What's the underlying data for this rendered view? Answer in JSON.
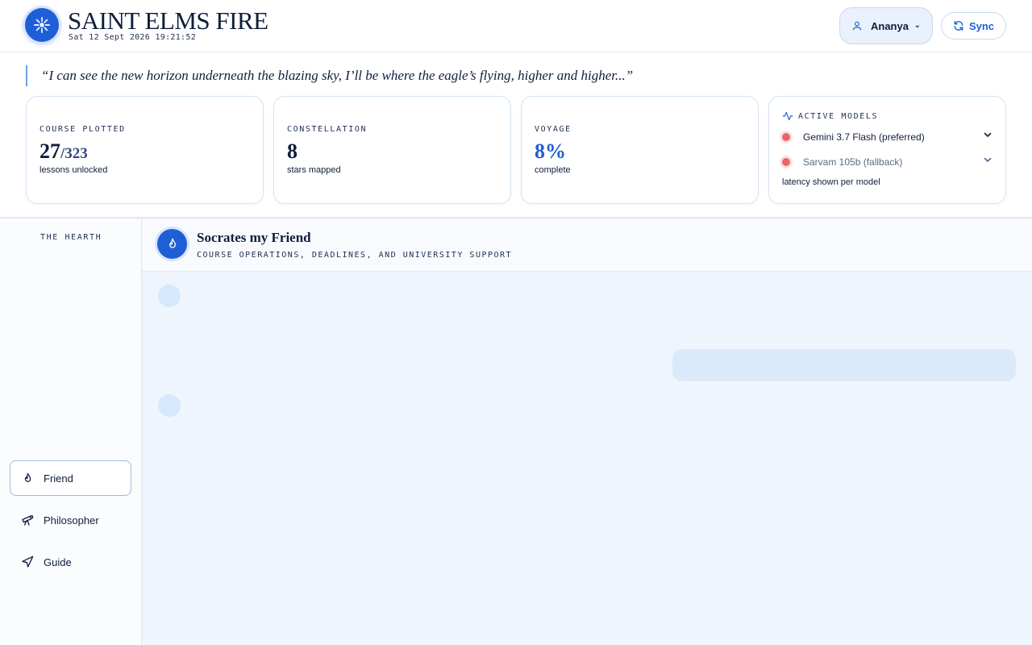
{
  "header": {
    "title": "SAINT ELMS FIRE",
    "datetime": "Sat 12 Sept 2026 19:21:52",
    "user_name": "Ananya",
    "sync_label": "Sync"
  },
  "quote": "“I can see the new horizon underneath the blazing sky, I’ll be where the eagle’s flying, higher and higher...”",
  "stats": {
    "course": {
      "label": "COURSE PLOTTED",
      "value": "27",
      "total": "/323",
      "sub": "lessons unlocked"
    },
    "constellation": {
      "label": "CONSTELLATION",
      "value": "8",
      "sub": "stars mapped"
    },
    "voyage": {
      "label": "VOYAGE",
      "value": "8%",
      "sub": "complete"
    }
  },
  "models": {
    "label": "ACTIVE MODELS",
    "items": [
      {
        "name": "Gemini 3.7 Flash (preferred)",
        "status_color": "#e8666a"
      },
      {
        "name": "Sarvam 105b (fallback)",
        "status_color": "#e8666a"
      }
    ],
    "note": "latency shown per model"
  },
  "sidebar": {
    "section": "THE HEARTH",
    "items": [
      {
        "label": "Friend",
        "icon": "flame-icon",
        "active": true
      },
      {
        "label": "Philosopher",
        "icon": "telescope-icon",
        "active": false
      },
      {
        "label": "Guide",
        "icon": "navigation-icon",
        "active": false
      }
    ]
  },
  "chat": {
    "title": "Socrates my Friend",
    "subtitle": "COURSE OPERATIONS, DEADLINES, AND UNIVERSITY SUPPORT"
  },
  "colors": {
    "accent": "#1f5fd6",
    "status": "#e8666a"
  }
}
